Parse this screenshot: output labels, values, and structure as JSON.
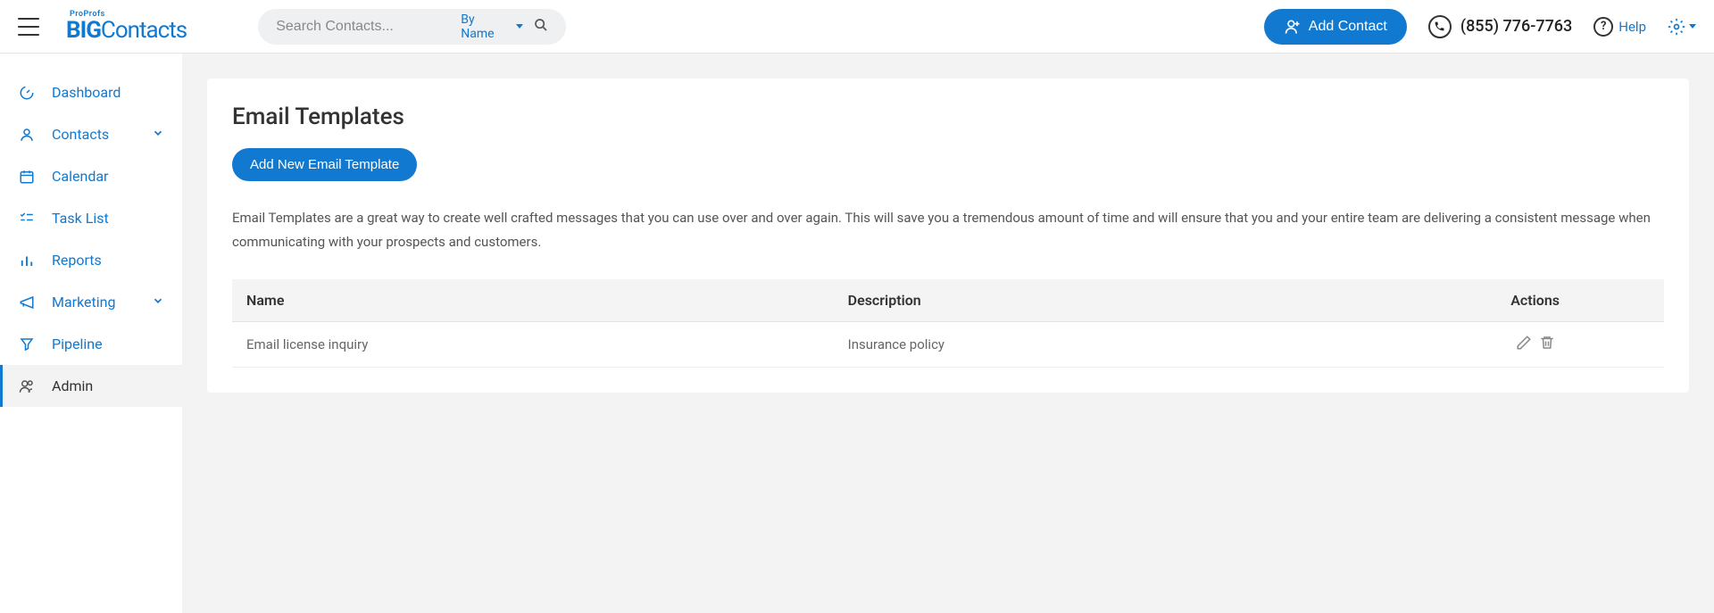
{
  "header": {
    "logo_small": "ProProfs",
    "logo_big_bold": "BIG",
    "logo_big_rest": "Contacts",
    "search_placeholder": "Search Contacts...",
    "by_name": "By Name",
    "add_contact": "Add Contact",
    "phone": "(855) 776-7763",
    "help": "Help"
  },
  "sidebar": {
    "items": [
      {
        "label": "Dashboard",
        "icon": "dashboard-icon"
      },
      {
        "label": "Contacts",
        "icon": "contacts-icon",
        "expandable": true
      },
      {
        "label": "Calendar",
        "icon": "calendar-icon"
      },
      {
        "label": "Task List",
        "icon": "tasklist-icon"
      },
      {
        "label": "Reports",
        "icon": "reports-icon"
      },
      {
        "label": "Marketing",
        "icon": "marketing-icon",
        "expandable": true
      },
      {
        "label": "Pipeline",
        "icon": "pipeline-icon"
      },
      {
        "label": "Admin",
        "icon": "admin-icon",
        "active": true
      }
    ]
  },
  "page": {
    "title": "Email Templates",
    "add_button": "Add New Email Template",
    "description": "Email Templates are a great way to create well crafted messages that you can use over and over again. This will save you a tremendous amount of time and will ensure that you and your entire team are delivering a consistent message when communicating with your prospects and customers."
  },
  "table": {
    "headers": {
      "name": "Name",
      "description": "Description",
      "actions": "Actions"
    },
    "rows": [
      {
        "name": "Email license inquiry",
        "description": "Insurance policy"
      }
    ]
  }
}
